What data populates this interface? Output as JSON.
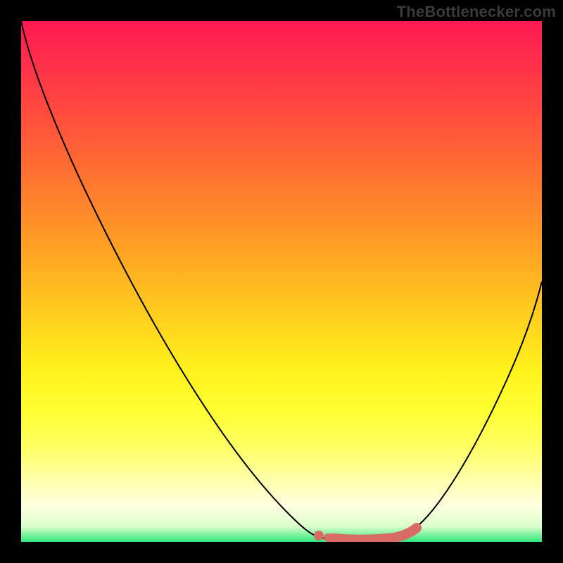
{
  "watermark": "TheBottlenecker.com",
  "chart_data": {
    "type": "line",
    "title": "",
    "xlabel": "",
    "ylabel": "",
    "xlim": [
      0,
      100
    ],
    "ylim": [
      0,
      100
    ],
    "x": [
      0,
      5,
      10,
      15,
      20,
      25,
      30,
      35,
      40,
      45,
      50,
      55,
      57,
      60,
      62,
      65,
      68,
      72,
      76,
      80,
      85,
      90,
      95,
      100
    ],
    "y": [
      100,
      91,
      82,
      73,
      64,
      55,
      46,
      37,
      28,
      19,
      11,
      5,
      3,
      1,
      0.5,
      0.3,
      0.3,
      0.6,
      2,
      6,
      14,
      24,
      36,
      50
    ],
    "gradient_stops": [
      {
        "pos": 0,
        "color": "#ff1a52"
      },
      {
        "pos": 8,
        "color": "#ff2f4a"
      },
      {
        "pos": 17,
        "color": "#ff4a3f"
      },
      {
        "pos": 27,
        "color": "#ff6a33"
      },
      {
        "pos": 37,
        "color": "#ff8a2a"
      },
      {
        "pos": 47,
        "color": "#ffad22"
      },
      {
        "pos": 57,
        "color": "#ffd01e"
      },
      {
        "pos": 67,
        "color": "#fff21c"
      },
      {
        "pos": 75,
        "color": "#ffff33"
      },
      {
        "pos": 82,
        "color": "#ffff66"
      },
      {
        "pos": 88,
        "color": "#ffffaa"
      },
      {
        "pos": 93,
        "color": "#ffffe0"
      },
      {
        "pos": 97,
        "color": "#ddffcc"
      },
      {
        "pos": 100,
        "color": "#2fe67a"
      }
    ],
    "highlight_range_x": [
      57,
      76
    ],
    "highlight_color": "#d86b64",
    "curve_color": "#000000",
    "background": "#000000"
  }
}
